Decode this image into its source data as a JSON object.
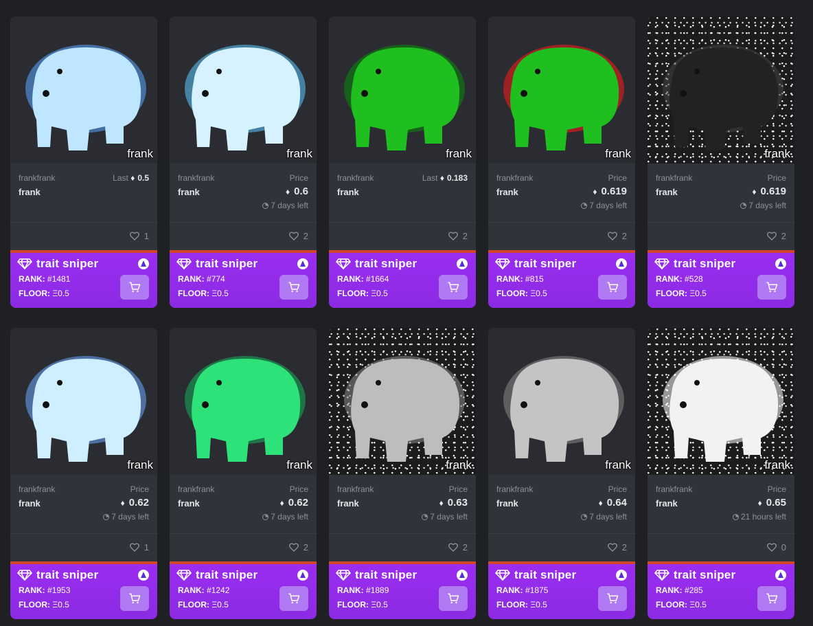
{
  "colors": {
    "bg": "#1f2023",
    "card": "#303339",
    "sniper": "#8a2be2",
    "accent_red": "#d2452b"
  },
  "sniper": {
    "title": "trait sniper",
    "rank_prefix": "RANK:",
    "floor_prefix": "FLOOR:",
    "floor_value": "Ξ0.5"
  },
  "cards": [
    {
      "collection": "frankfrank",
      "name": "frank",
      "watermark": "frank",
      "mode": "last",
      "last_label": "Last",
      "price": "0.5",
      "time": "",
      "likes": "1",
      "rank": "#1481",
      "bear": "#bfe6ff",
      "glow": "#5aa8ff",
      "bg": "dark"
    },
    {
      "collection": "frankfrank",
      "name": "frank",
      "watermark": "frank",
      "mode": "price",
      "price_label": "Price",
      "price": "0.6",
      "time": "7 days left",
      "likes": "2",
      "rank": "#774",
      "bear": "#d6f2ff",
      "glow": "#5ac8ff",
      "bg": "dark"
    },
    {
      "collection": "frankfrank",
      "name": "frank",
      "watermark": "frank",
      "mode": "last",
      "last_label": "Last",
      "price": "0.183",
      "time": "",
      "likes": "2",
      "rank": "#1664",
      "bear": "#1fbf1f",
      "glow": "#0a8a0a",
      "bg": "dark"
    },
    {
      "collection": "frankfrank",
      "name": "frank",
      "watermark": "frank",
      "mode": "price",
      "price_label": "Price",
      "price": "0.619",
      "time": "7 days left",
      "likes": "2",
      "rank": "#815",
      "bear": "#1fbf1f",
      "glow": "#ff1a1a",
      "bg": "dark"
    },
    {
      "collection": "frankfrank",
      "name": "frank",
      "watermark": "frank",
      "mode": "price",
      "price_label": "Price",
      "price": "0.619",
      "time": "7 days left",
      "likes": "2",
      "rank": "#528",
      "bear": "#222222",
      "glow": "#444444",
      "bg": "noise"
    },
    {
      "collection": "frankfrank",
      "name": "frank",
      "watermark": "frank",
      "mode": "price",
      "price_label": "Price",
      "price": "0.62",
      "time": "7 days left",
      "likes": "1",
      "rank": "#1953",
      "bear": "#cfeeff",
      "glow": "#6aa8ff",
      "bg": "dark"
    },
    {
      "collection": "frankfrank",
      "name": "frank",
      "watermark": "frank",
      "mode": "price",
      "price_label": "Price",
      "price": "0.62",
      "time": "7 days left",
      "likes": "2",
      "rank": "#1242",
      "bear": "#2ee27a",
      "glow": "#14b05a",
      "bg": "dark"
    },
    {
      "collection": "frankfrank",
      "name": "frank",
      "watermark": "frank",
      "mode": "price",
      "price_label": "Price",
      "price": "0.63",
      "time": "7 days left",
      "likes": "2",
      "rank": "#1889",
      "bear": "#bdbdbd",
      "glow": "#888888",
      "bg": "noise"
    },
    {
      "collection": "frankfrank",
      "name": "frank",
      "watermark": "frank",
      "mode": "price",
      "price_label": "Price",
      "price": "0.64",
      "time": "7 days left",
      "likes": "2",
      "rank": "#1875",
      "bear": "#c4c4c4",
      "glow": "#888888",
      "bg": "dark"
    },
    {
      "collection": "frankfrank",
      "name": "frank",
      "watermark": "frank",
      "mode": "price",
      "price_label": "Price",
      "price": "0.65",
      "time": "21 hours left",
      "likes": "0",
      "rank": "#285",
      "bear": "#f2f2f2",
      "glow": "#ffffff",
      "bg": "noise"
    }
  ]
}
